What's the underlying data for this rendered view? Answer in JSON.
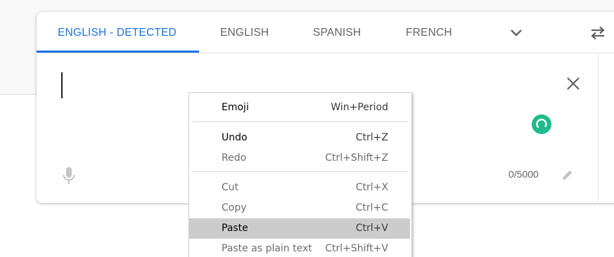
{
  "tabs": [
    {
      "label": "ENGLISH - DETECTED",
      "active": true
    },
    {
      "label": "ENGLISH",
      "active": false
    },
    {
      "label": "SPANISH",
      "active": false
    },
    {
      "label": "FRENCH",
      "active": false
    }
  ],
  "icons": {
    "more_languages": "chevron-down-icon",
    "swap": "swap-languages-icon",
    "clear": "close-icon",
    "mic": "microphone-icon",
    "edit": "pencil-icon",
    "loading": "loading-spinner-icon"
  },
  "input": {
    "value": "",
    "char_count": "0/5000"
  },
  "context_menu": {
    "items": [
      {
        "label": "Emoji",
        "shortcut": "Win+Period",
        "enabled": true,
        "highlighted": false
      },
      {
        "label": "Undo",
        "shortcut": "Ctrl+Z",
        "enabled": true,
        "highlighted": false
      },
      {
        "label": "Redo",
        "shortcut": "Ctrl+Shift+Z",
        "enabled": false,
        "highlighted": false
      },
      {
        "label": "Cut",
        "shortcut": "Ctrl+X",
        "enabled": false,
        "highlighted": false
      },
      {
        "label": "Copy",
        "shortcut": "Ctrl+C",
        "enabled": false,
        "highlighted": false
      },
      {
        "label": "Paste",
        "shortcut": "Ctrl+V",
        "enabled": true,
        "highlighted": true
      },
      {
        "label": "Paste as plain text",
        "shortcut": "Ctrl+Shift+V",
        "enabled": false,
        "highlighted": false
      }
    ]
  },
  "colors": {
    "accent": "#1a73e8",
    "spinner": "#1ebc8c",
    "menu_highlight": "#cccccc",
    "tab_text": "#5f6368"
  }
}
